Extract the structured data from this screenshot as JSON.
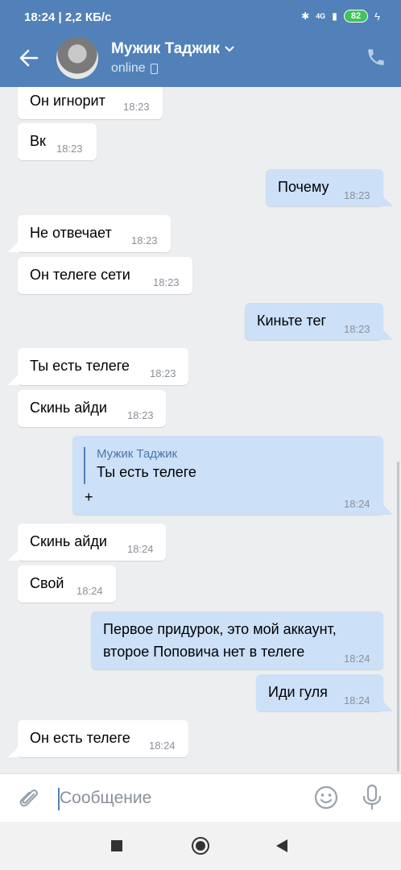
{
  "status_bar": {
    "time_speed": "18:24 | 2,2 КБ/с",
    "network": "4G",
    "battery": "82"
  },
  "header": {
    "name": "Мужик Таджик",
    "status": "online"
  },
  "messages": [
    {
      "dir": "in",
      "text": "Он игнорит",
      "time": "18:23"
    },
    {
      "dir": "in",
      "text": "Вк",
      "time": "18:23"
    },
    {
      "dir": "out",
      "text": "Почему",
      "time": "18:23"
    },
    {
      "dir": "in",
      "text": "Не отвечает",
      "time": "18:23"
    },
    {
      "dir": "in",
      "text": "Он телеге  сети",
      "time": "18:23"
    },
    {
      "dir": "out",
      "text": "Киньте тег",
      "time": "18:23"
    },
    {
      "dir": "in",
      "text": "Ты есть телеге",
      "time": "18:23"
    },
    {
      "dir": "in",
      "text": "Скинь айди",
      "time": "18:23"
    },
    {
      "dir": "out",
      "reply_author": "Мужик Таджик",
      "reply_text": "Ты есть телеге",
      "text": "+",
      "time": "18:24"
    },
    {
      "dir": "in",
      "text": "Скинь айди",
      "time": "18:24"
    },
    {
      "dir": "in",
      "text": "Свой",
      "time": "18:24"
    },
    {
      "dir": "out",
      "text_line1": "Первое придурок, это мой аккаунт,",
      "text_line2": "второе Поповича нет в телеге",
      "time": "18:24"
    },
    {
      "dir": "out",
      "text": "Иди гуля",
      "time": "18:24"
    },
    {
      "dir": "in",
      "text": "Он есть телеге",
      "time": "18:24"
    }
  ],
  "composer": {
    "placeholder": "Сообщение"
  },
  "colors": {
    "header": "#5181b8",
    "outgoing": "#cce0f8",
    "incoming": "#ffffff",
    "background": "#edeef0"
  }
}
